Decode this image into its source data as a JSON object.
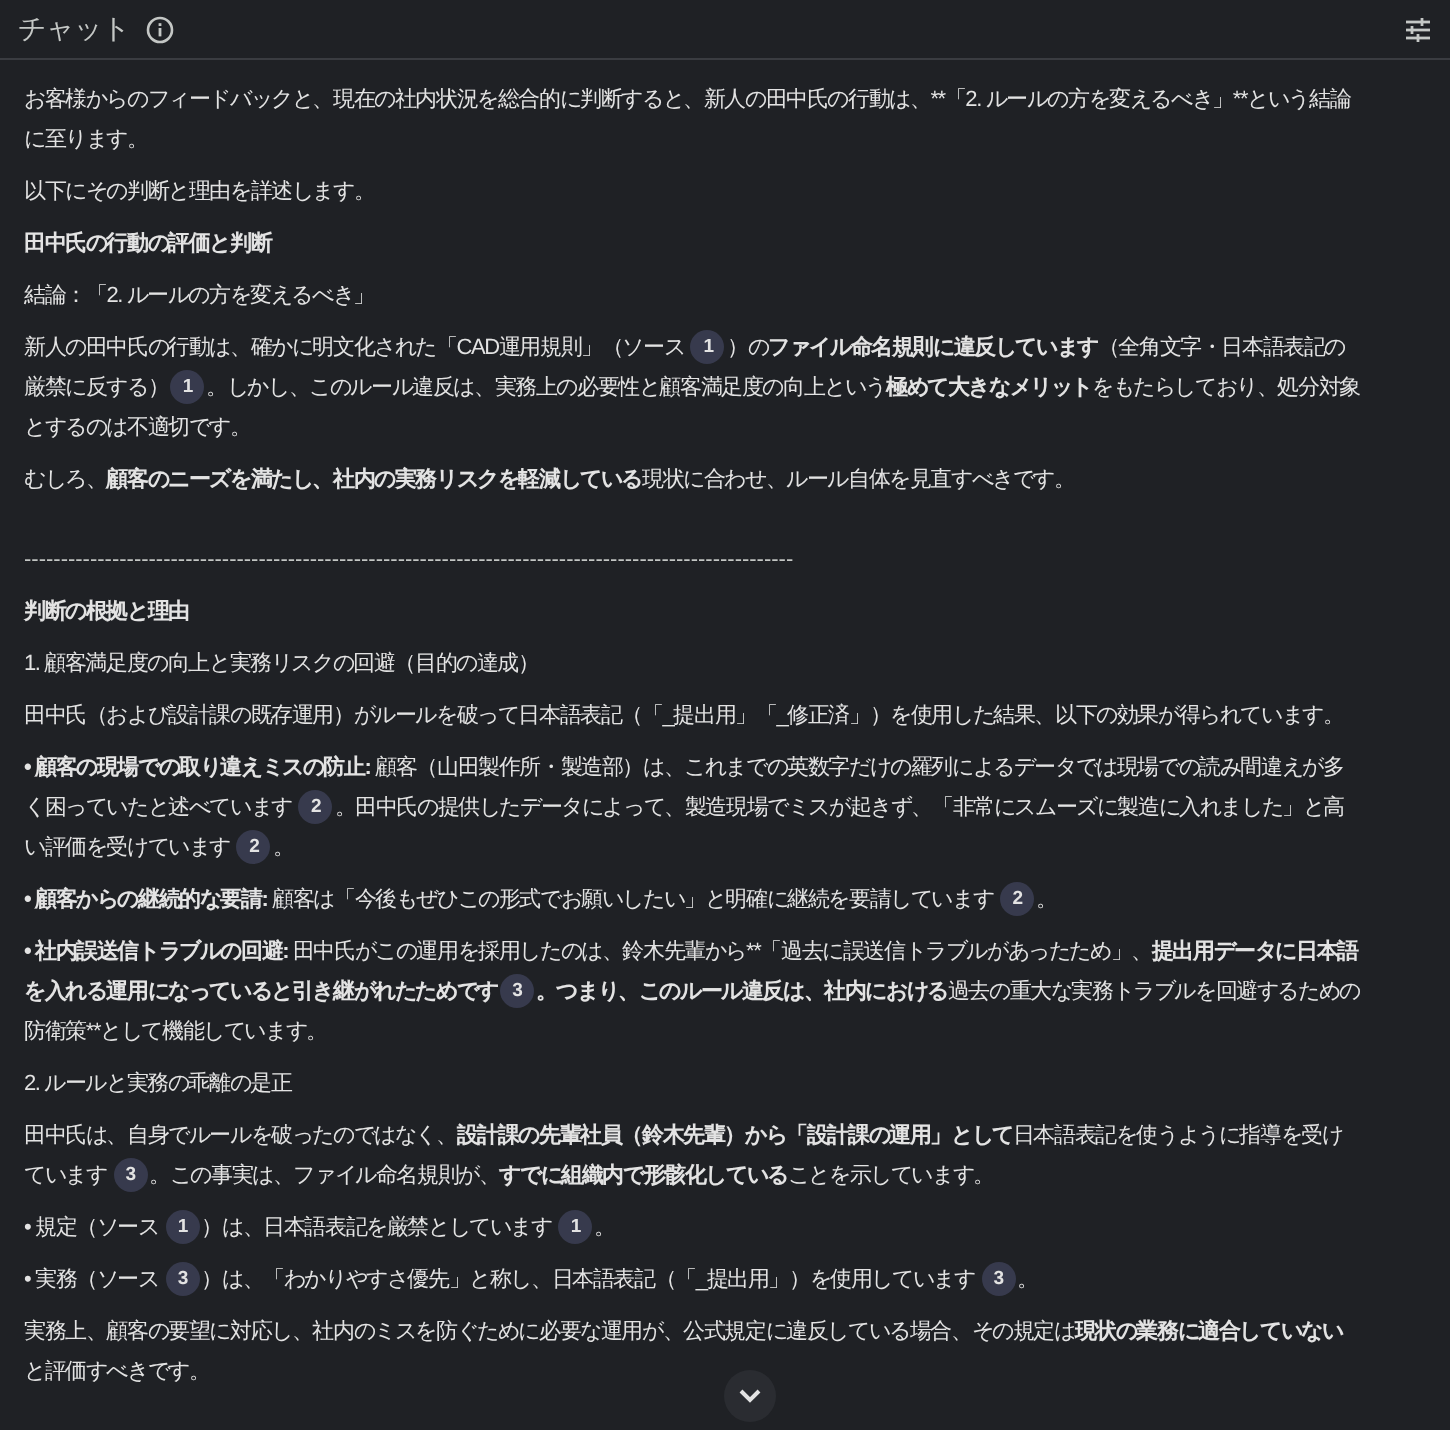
{
  "header": {
    "title": "チャット"
  },
  "paragraphs": [
    {
      "kind": "text",
      "parts": [
        {
          "text": "お客様からのフィードバックと、現在の社内状況を総合的に判断すると、新人の田中氏の行動は、**「2. ルールの方を変えるべき」**という結論に至ります。",
          "bold": false
        }
      ]
    },
    {
      "kind": "text",
      "parts": [
        {
          "text": "以下にその判断と理由を詳述します。",
          "bold": false
        }
      ]
    },
    {
      "kind": "text",
      "parts": [
        {
          "text": "田中氏の行動の評価と判断",
          "bold": true
        }
      ]
    },
    {
      "kind": "text",
      "parts": [
        {
          "text": "結論：「2. ルールの方を変えるべき」",
          "bold": false
        }
      ]
    },
    {
      "kind": "text",
      "parts": [
        {
          "text": "新人の田中氏の行動は、確かに明文化された「CAD運用規則」（ソース ",
          "bold": false
        },
        {
          "cite": "1"
        },
        {
          "text": "）の",
          "bold": false
        },
        {
          "text": "ファイル命名規則に違反しています",
          "bold": true
        },
        {
          "text": "（全角文字・日本語表記の厳禁に反する）",
          "bold": false
        },
        {
          "cite": "1"
        },
        {
          "text": "。しかし、このルール違反は、実務上の必要性と顧客満足度の向上という",
          "bold": false
        },
        {
          "text": "極めて大きなメリット",
          "bold": true
        },
        {
          "text": "をもたらしており、処分対象とするのは不適切です。",
          "bold": false
        }
      ]
    },
    {
      "kind": "text",
      "parts": [
        {
          "text": "むしろ、",
          "bold": false
        },
        {
          "text": "顧客のニーズを満たし、社内の実務リスクを軽減している",
          "bold": true
        },
        {
          "text": "現状に合わせ、ルール自体を見直すべきです。",
          "bold": false
        }
      ]
    },
    {
      "kind": "rule",
      "parts": [
        {
          "text": "---------------------------------------------------------------------------------------------------------",
          "bold": false
        }
      ]
    },
    {
      "kind": "text",
      "parts": [
        {
          "text": "判断の根拠と理由",
          "bold": true
        }
      ]
    },
    {
      "kind": "text",
      "parts": [
        {
          "text": "1. 顧客満足度の向上と実務リスクの回避（目的の達成）",
          "bold": false
        }
      ]
    },
    {
      "kind": "text",
      "parts": [
        {
          "text": "田中氏（および設計課の既存運用）がルールを破って日本語表記（「_提出用」「_修正済」）を使用した結果、以下の効果が得られています。",
          "bold": false
        }
      ]
    },
    {
      "kind": "text",
      "parts": [
        {
          "text": "• 顧客の現場での取り違えミスの防止:",
          "bold": true
        },
        {
          "text": " 顧客（山田製作所・製造部）は、これまでの英数字だけの羅列によるデータでは現場での読み間違えが多く困っていたと述べています ",
          "bold": false
        },
        {
          "cite": "2"
        },
        {
          "text": "。田中氏の提供したデータによって、製造現場でミスが起きず、「非常にスムーズに製造に入れました」と高い評価を受けています ",
          "bold": false
        },
        {
          "cite": "2"
        },
        {
          "text": "。",
          "bold": false
        }
      ]
    },
    {
      "kind": "text",
      "parts": [
        {
          "text": "• 顧客からの継続的な要請:",
          "bold": true
        },
        {
          "text": " 顧客は「今後もぜひこの形式でお願いしたい」と明確に継続を要請しています ",
          "bold": false
        },
        {
          "cite": "2"
        },
        {
          "text": "。",
          "bold": false
        }
      ]
    },
    {
      "kind": "text",
      "parts": [
        {
          "text": "• 社内誤送信トラブルの回避:",
          "bold": true
        },
        {
          "text": " 田中氏がこの運用を採用したのは、鈴木先輩から**「過去に誤送信トラブルがあったため」、",
          "bold": false
        },
        {
          "text": "提出用データに日本語を入れる運用になっていると引き継がれたためです",
          "bold": true
        },
        {
          "cite": "3"
        },
        {
          "text": "。つまり、このルール違反は、社内における",
          "bold": true
        },
        {
          "text": "過去の重大な実務トラブルを回避するための防衛策**として機能しています。",
          "bold": false
        }
      ]
    },
    {
      "kind": "text",
      "parts": [
        {
          "text": "2. ルールと実務の乖離の是正",
          "bold": false
        }
      ]
    },
    {
      "kind": "text",
      "parts": [
        {
          "text": "田中氏は、自身でルールを破ったのではなく、",
          "bold": false
        },
        {
          "text": "設計課の先輩社員（鈴木先輩）から「設計課の運用」として",
          "bold": true
        },
        {
          "text": "日本語表記を使うように指導を受けています ",
          "bold": false
        },
        {
          "cite": "3"
        },
        {
          "text": "。この事実は、ファイル命名規則が、",
          "bold": false
        },
        {
          "text": "すでに組織内で形骸化している",
          "bold": true
        },
        {
          "text": "ことを示しています。",
          "bold": false
        }
      ]
    },
    {
      "kind": "text",
      "parts": [
        {
          "text": "• 規定（ソース ",
          "bold": false
        },
        {
          "cite": "1"
        },
        {
          "text": "）は、日本語表記を厳禁としています ",
          "bold": false
        },
        {
          "cite": "1"
        },
        {
          "text": "。",
          "bold": false
        }
      ]
    },
    {
      "kind": "text",
      "parts": [
        {
          "text": "• 実務（ソース ",
          "bold": false
        },
        {
          "cite": "3"
        },
        {
          "text": "）は、「わかりやすさ優先」と称し、日本語表記（「_提出用」）を使用しています ",
          "bold": false
        },
        {
          "cite": "3"
        },
        {
          "text": "。",
          "bold": false
        }
      ]
    },
    {
      "kind": "text",
      "parts": [
        {
          "text": "実務上、顧客の要望に対応し、社内のミスを防ぐために必要な運用が、公式規定に違反している場合、その規定は",
          "bold": false
        },
        {
          "text": "現状の業務に適合していない",
          "bold": true
        },
        {
          "text": "と評価すべきです。",
          "bold": false
        }
      ]
    }
  ]
}
